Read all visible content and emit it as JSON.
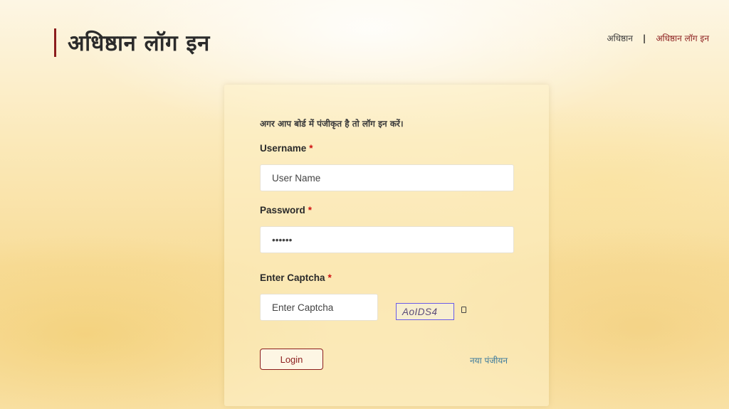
{
  "header": {
    "title": "अधिष्ठान लॉग इन"
  },
  "breadcrumb": {
    "home": "अधिष्ठान",
    "separator": "|",
    "current": "अधिष्ठान लॉग इन"
  },
  "form": {
    "intro": "अगर आप बोर्ड में पंजीकृत है तो लॉग इन करें।",
    "required_marker": "*",
    "username": {
      "label": "Username",
      "placeholder": "User Name",
      "value": ""
    },
    "password": {
      "label": "Password",
      "placeholder": "",
      "value": "******"
    },
    "captcha": {
      "label": "Enter Captcha",
      "placeholder": "Enter Captcha",
      "code": "AoIDS4"
    },
    "login_label": "Login",
    "register_label": "नया पंजीयन"
  },
  "colors": {
    "accent": "#8b1d1d",
    "required": "#d01010",
    "link": "#3c7a9c",
    "captcha_border": "#6a5ce8"
  },
  "icons": {
    "captcha_refresh": "refresh-icon"
  }
}
